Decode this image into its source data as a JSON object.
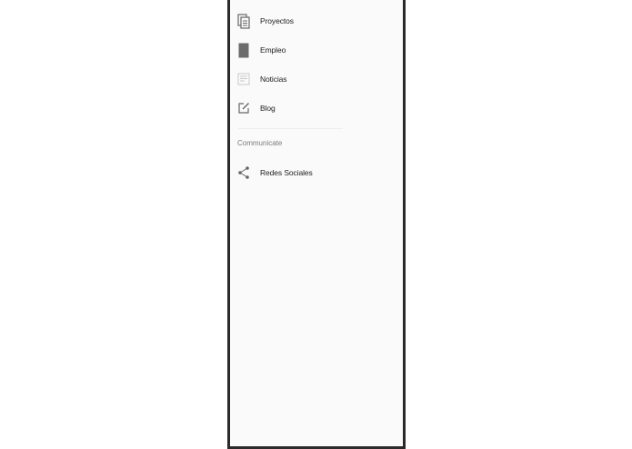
{
  "drawer": {
    "items": [
      {
        "label": "Proyectos",
        "icon": "document-stack-icon"
      },
      {
        "label": "Empleo",
        "icon": "briefcase-icon"
      },
      {
        "label": "Noticias",
        "icon": "newspaper-icon"
      },
      {
        "label": "Blog",
        "icon": "edit-square-icon"
      }
    ],
    "section_header": "Communicate",
    "section_items": [
      {
        "label": "Redes Sociales",
        "icon": "share-icon"
      }
    ]
  },
  "colors": {
    "drawer_bg": "#fafafa",
    "frame": "#2a2a2a",
    "icon": "#666666",
    "text": "#222222",
    "section_text": "#7a7a7a"
  }
}
